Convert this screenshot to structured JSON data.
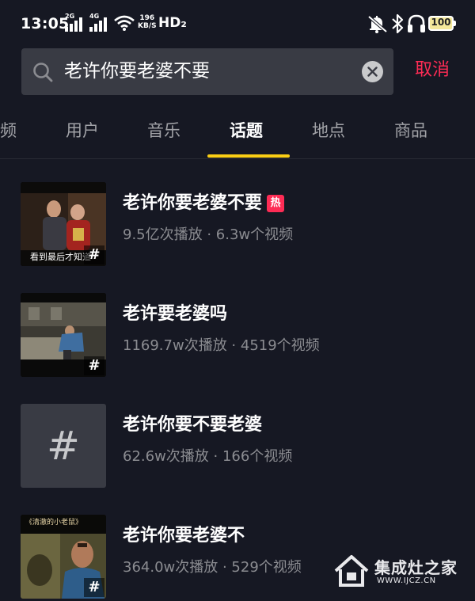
{
  "status_bar": {
    "time": "13:05",
    "sim1_tag": "2G",
    "sim2_tag": "4G",
    "net_speed_value": "196",
    "net_speed_unit": "KB/S",
    "hd_label": "HD₂",
    "battery_level": "100",
    "icons": [
      "wifi-icon",
      "mute-icon",
      "bluetooth-icon",
      "headset-icon",
      "battery-icon"
    ]
  },
  "search": {
    "query": "老许你要老婆不要",
    "cancel_label": "取消"
  },
  "tabs": [
    {
      "label": "频"
    },
    {
      "label": "用户"
    },
    {
      "label": "音乐"
    },
    {
      "label": "话题",
      "active": true
    },
    {
      "label": "地点"
    },
    {
      "label": "商品"
    }
  ],
  "results": [
    {
      "title": "老许你要老婆不要",
      "hot_badge": "热",
      "stats": "9.5亿次播放 · 6.3w个视频",
      "thumb_caption": "看到最后才知道",
      "hash": "#"
    },
    {
      "title": "老许要老婆吗",
      "stats": "1169.7w次播放 · 4519个视频",
      "hash": "#"
    },
    {
      "title": "老许你要不要老婆",
      "stats": "62.6w次播放 · 166个视频",
      "hash": "#"
    },
    {
      "title": "老许你要老婆不",
      "stats": "364.0w次播放 · 529个视频",
      "thumb_text": "《清澈的小老鼠》",
      "hash": "#"
    }
  ],
  "watermark": {
    "name": "集成灶之家",
    "url": "WWW.IJCZ.CN"
  },
  "colors": {
    "background": "#161823",
    "search_bg": "#393b44",
    "accent_red": "#fe2c55",
    "tab_indicator": "#face15",
    "muted_text": "#8b8c91"
  }
}
